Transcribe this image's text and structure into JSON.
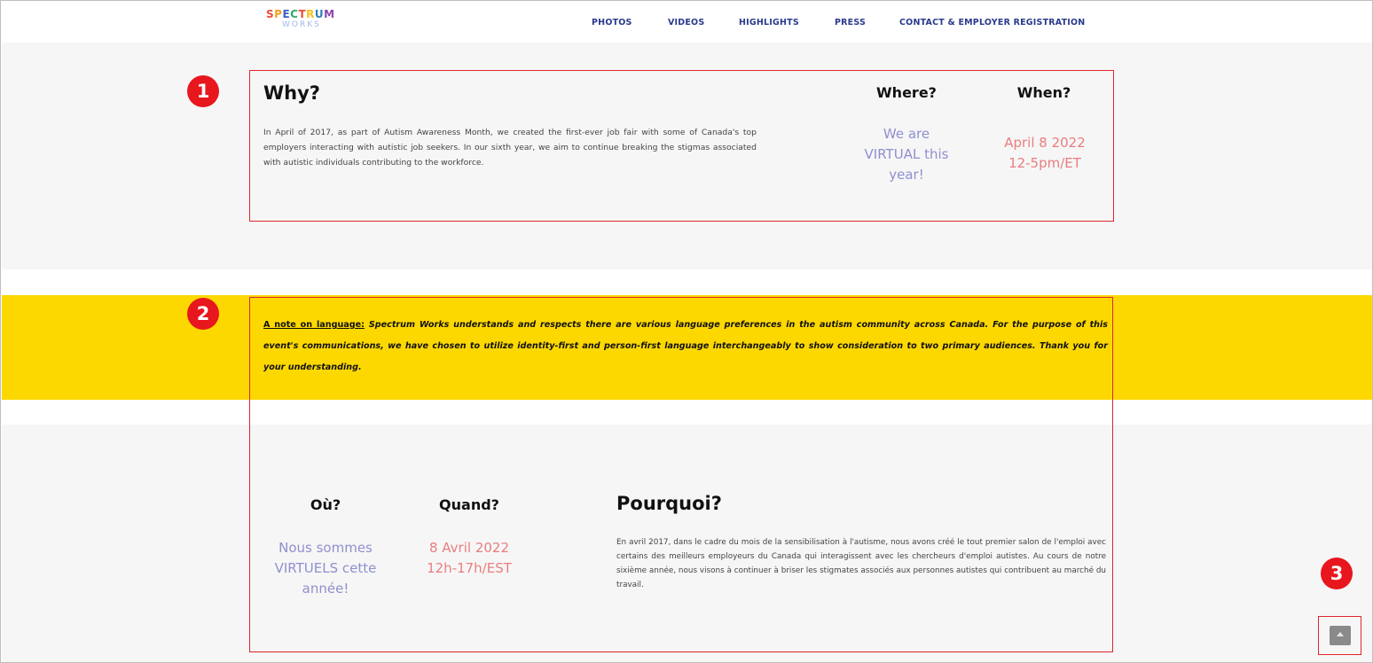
{
  "header": {
    "logo_letters": [
      {
        "ch": "S",
        "color": "#e84c3d"
      },
      {
        "ch": "P",
        "color": "#f4a21e"
      },
      {
        "ch": "E",
        "color": "#3d5fc4"
      },
      {
        "ch": "C",
        "color": "#27ae60"
      },
      {
        "ch": "T",
        "color": "#e84c3d"
      },
      {
        "ch": "R",
        "color": "#f4c21e"
      },
      {
        "ch": "U",
        "color": "#2980b9"
      },
      {
        "ch": "M",
        "color": "#8e44ad"
      }
    ],
    "logo_sub": "WORKS",
    "nav": [
      "PHOTOS",
      "VIDEOS",
      "HIGHLIGHTS",
      "PRESS",
      "CONTACT & EMPLOYER REGISTRATION"
    ]
  },
  "badges": [
    "1",
    "2",
    "3"
  ],
  "english": {
    "why_heading": "Why?",
    "why_text": "In April of 2017, as part of Autism Awareness Month, we created the first-ever job fair with some of Canada's top employers interacting with autistic job seekers. In our sixth year, we aim to continue breaking the stigmas associated with autistic individuals contributing to the workforce.",
    "where_heading": "Where?",
    "where_text_l1": "We are",
    "where_text_l2": "VIRTUAL this",
    "where_text_l3": "year!",
    "when_heading": "When?",
    "when_text_l1": "April 8 2022",
    "when_text_l2": "12-5pm/ET"
  },
  "note": {
    "lead": "A note on language:",
    "text": " Spectrum Works understands and respects there are various language preferences in the autism community across Canada. For the purpose of this event's communications, we have chosen to utilize identity-first and person-first language interchangeably to show consideration to two primary audiences. Thank you for your understanding."
  },
  "french": {
    "ou_heading": "Où?",
    "ou_text_l1": "Nous sommes",
    "ou_text_l2": "VIRTUELS cette",
    "ou_text_l3": "année!",
    "quand_heading": "Quand?",
    "quand_text_l1": "8 Avril 2022",
    "quand_text_l2": "12h-17h/EST",
    "pourquoi_heading": "Pourquoi?",
    "pourquoi_text": "En avril 2017, dans le cadre du mois de la sensibilisation à l'autisme, nous avons créé le tout premier salon de l'emploi avec certains des meilleurs employeurs du Canada qui interagissent avec les chercheurs d'emploi autistes. Au cours de notre sixième année, nous visons à continuer à briser les stigmates associés aux personnes autistes qui contribuent au marché du travail."
  },
  "colors": {
    "accent_yellow": "#fdd800",
    "annotation_red": "#e0262b",
    "lavender": "#8f90cf",
    "pink": "#ea7d7f",
    "nav_blue": "#2a3a8c"
  },
  "icons": {
    "scroll_top": "chevron-up-icon"
  }
}
